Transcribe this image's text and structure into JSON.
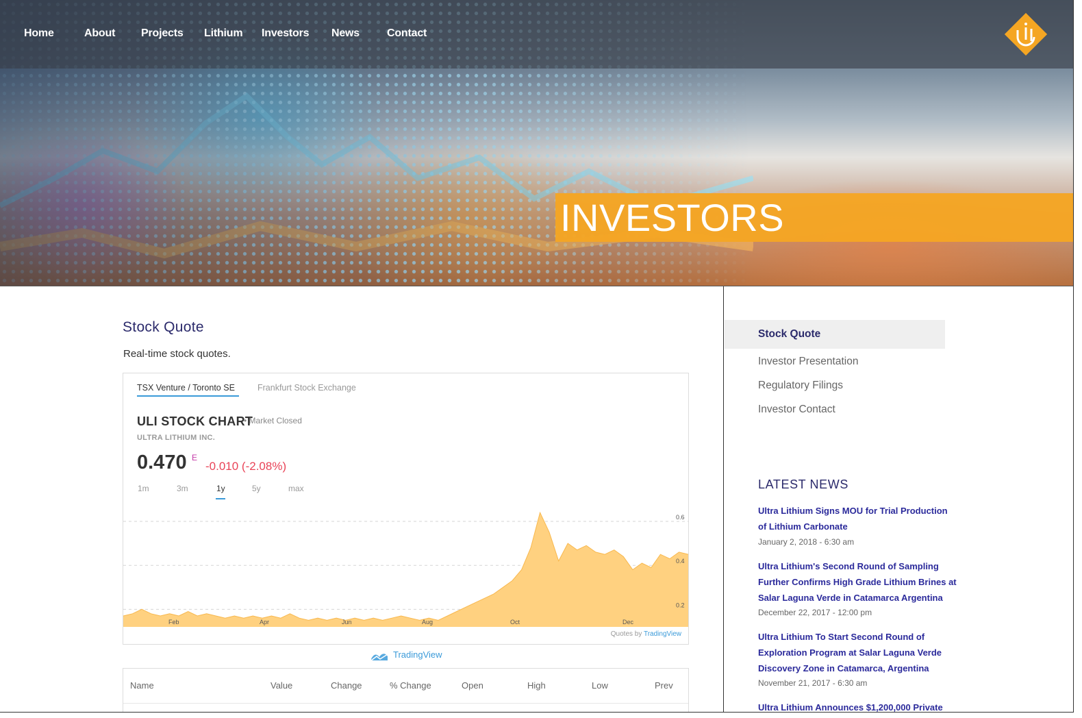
{
  "nav": {
    "items": [
      "Home",
      "About",
      "Projects",
      "Lithium",
      "Investors",
      "News",
      "Contact"
    ]
  },
  "hero": {
    "title": "INVESTORS",
    "accent_color": "#f5a623"
  },
  "main": {
    "section_title": "Stock Quote",
    "section_subtitle": "Real-time stock quotes."
  },
  "widget": {
    "tabs": [
      "TSX Venture / Toronto SE",
      "Frankfurt Stock Exchange"
    ],
    "active_tab": "TSX Venture / Toronto SE",
    "chart_title": "ULI STOCK CHART",
    "market_status": "• Market Closed",
    "company": "ULTRA LITHIUM INC.",
    "price": "0.470",
    "price_flag": "E",
    "change": "-0.010 (-2.08%)",
    "ranges": [
      "1m",
      "3m",
      "1y",
      "5y",
      "max"
    ],
    "active_range": "1y",
    "quotes_by_prefix": "Quotes by ",
    "quotes_by_brand": "TradingView",
    "tv_brand": "TradingView"
  },
  "chart_data": {
    "type": "area",
    "x_tick_labels": [
      "Feb",
      "Apr",
      "Jun",
      "Aug",
      "Oct",
      "Dec"
    ],
    "y_tick_labels": [
      "0.6",
      "0.4",
      "0.2"
    ],
    "ylim": [
      0.12,
      0.65
    ],
    "grid": true,
    "series": [
      {
        "values": [
          0.17,
          0.18,
          0.2,
          0.18,
          0.17,
          0.18,
          0.17,
          0.19,
          0.17,
          0.18,
          0.17,
          0.16,
          0.17,
          0.16,
          0.17,
          0.16,
          0.17,
          0.16,
          0.18,
          0.16,
          0.15,
          0.16,
          0.15,
          0.16,
          0.15,
          0.16,
          0.15,
          0.16,
          0.15,
          0.16,
          0.17,
          0.16,
          0.15,
          0.16,
          0.15,
          0.17,
          0.19,
          0.21,
          0.23,
          0.25,
          0.27,
          0.3,
          0.33,
          0.38,
          0.48,
          0.64,
          0.55,
          0.42,
          0.5,
          0.47,
          0.49,
          0.46,
          0.45,
          0.47,
          0.44,
          0.38,
          0.41,
          0.39,
          0.45,
          0.43,
          0.46,
          0.45
        ]
      }
    ]
  },
  "table": {
    "headers": [
      "Name",
      "Value",
      "Change",
      "% Change",
      "Open",
      "High",
      "Low",
      "Prev"
    ]
  },
  "sidebar": {
    "links": [
      "Stock Quote",
      "Investor Presentation",
      "Regulatory Filings",
      "Investor Contact"
    ],
    "active": "Stock Quote",
    "news_heading": "LATEST NEWS",
    "news": [
      {
        "title": "Ultra Lithium Signs MOU for Trial Production of Lithium Carbonate",
        "date": "January 2, 2018 - 6:30 am"
      },
      {
        "title": "Ultra Lithium's Second Round of Sampling Further Confirms High Grade Lithium Brines at Salar Laguna Verde in Catamarca Argentina",
        "date": "December 22, 2017 - 12:00 pm"
      },
      {
        "title": "Ultra Lithium To Start Second Round of Exploration Program at Salar Laguna Verde Discovery Zone in Catamarca, Argentina",
        "date": "November 21, 2017 - 6:30 am"
      },
      {
        "title": "Ultra Lithium Announces $1,200,000 Private",
        "date": ""
      }
    ]
  },
  "colors": {
    "brand_navy": "#2b2a6b",
    "link_blue": "#2b2a9b",
    "chart_fill": "#ffd180",
    "negative": "#e94357"
  }
}
